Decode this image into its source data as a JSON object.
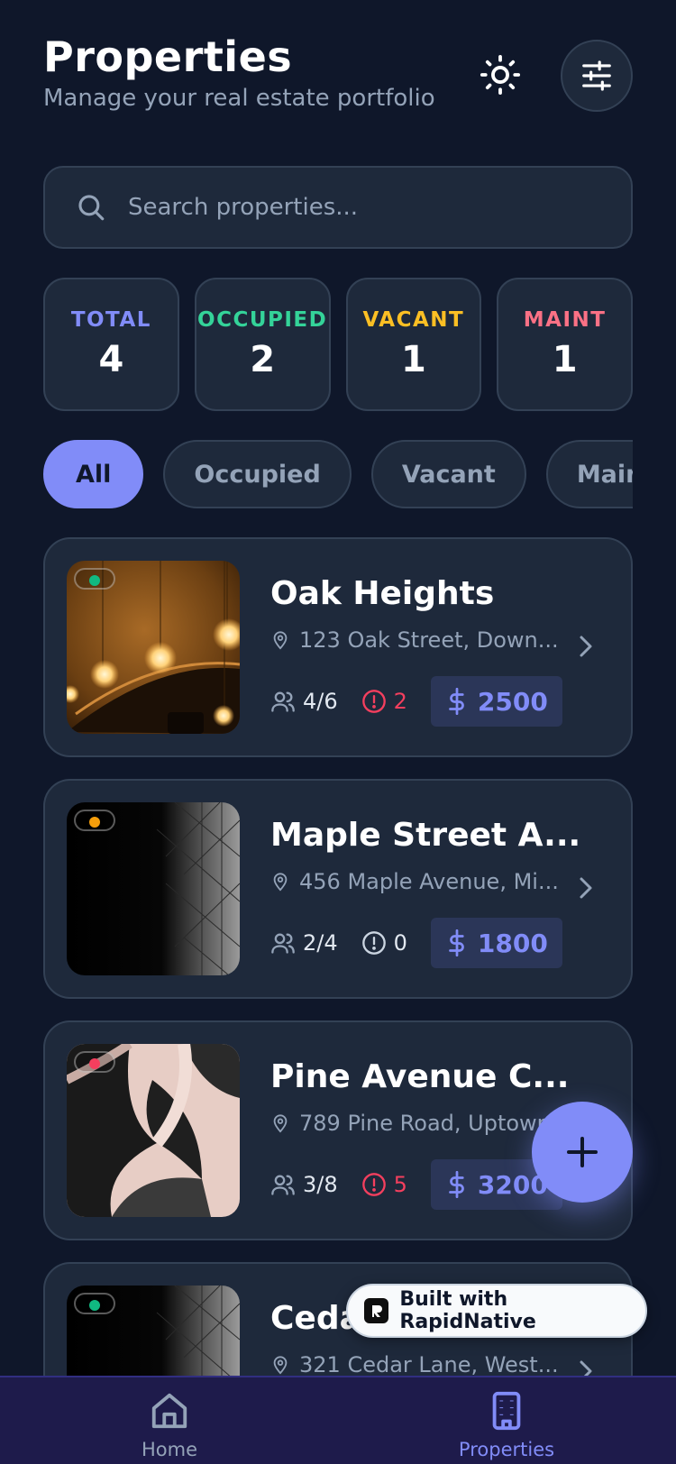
{
  "header": {
    "title": "Properties",
    "subtitle": "Manage your real estate portfolio",
    "theme_icon": "sun-icon",
    "filter_icon": "sliders-icon"
  },
  "search": {
    "placeholder": "Search properties...",
    "value": ""
  },
  "stats": [
    {
      "label": "TOTAL",
      "value": "4",
      "color": "#818cf8"
    },
    {
      "label": "OCCUPIED",
      "value": "2",
      "color": "#34d399"
    },
    {
      "label": "VACANT",
      "value": "1",
      "color": "#fbbf24"
    },
    {
      "label": "MAINT",
      "value": "1",
      "color": "#fb7185"
    }
  ],
  "filters": [
    "All",
    "Occupied",
    "Vacant",
    "Maint"
  ],
  "active_filter": "All",
  "properties": [
    {
      "name": "Oak Heights",
      "address": "123 Oak Street, Down...",
      "units": "4/6",
      "issues": "2",
      "issues_color": "#f43f5e",
      "rent": "2500",
      "status_color": "#10b981"
    },
    {
      "name": "Maple Street A...",
      "address": "456 Maple Avenue, Mi...",
      "units": "2/4",
      "issues": "0",
      "issues_color": "#cbd5e1",
      "rent": "1800",
      "status_color": "#f59e0b"
    },
    {
      "name": "Pine Avenue C...",
      "address": "789 Pine Road, Uptown",
      "units": "3/8",
      "issues": "5",
      "issues_color": "#f43f5e",
      "rent": "3200",
      "status_color": "#f43f5e"
    },
    {
      "name": "Ceda",
      "address": "321 Cedar Lane, West...",
      "status_color": "#10b981"
    }
  ],
  "fab": {
    "icon": "plus-icon"
  },
  "badge": {
    "text": "Built with RapidNative"
  },
  "tabs": [
    {
      "label": "Home",
      "icon": "home-icon",
      "active": false
    },
    {
      "label": "Properties",
      "icon": "building-icon",
      "active": true
    }
  ],
  "colors": {
    "accent": "#818cf8",
    "background": "#0f172a",
    "card": "#1e293b"
  }
}
